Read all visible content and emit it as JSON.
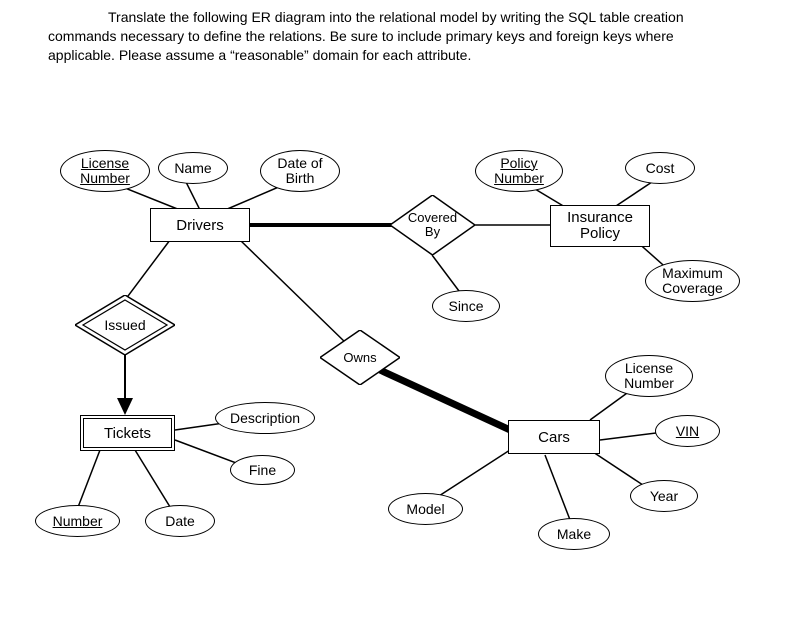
{
  "instructions": {
    "line1": "Translate the following ER diagram into the relational model by writing the SQL table creation",
    "line2": "commands necessary to define the relations. Be sure to include primary keys and foreign keys where",
    "line3": "applicable. Please assume a “reasonable” domain for each attribute."
  },
  "entities": {
    "drivers": {
      "label": "Drivers"
    },
    "insurance_policy": {
      "label": "Insurance\nPolicy"
    },
    "tickets": {
      "label": "Tickets"
    },
    "cars": {
      "label": "Cars"
    }
  },
  "relationships": {
    "covered_by": {
      "label": "Covered\nBy"
    },
    "issued": {
      "label": "Issued"
    },
    "owns": {
      "label": "Owns"
    }
  },
  "attributes": {
    "license_number_driver": {
      "label": "License\nNumber",
      "key": true
    },
    "name": {
      "label": "Name",
      "key": false
    },
    "date_of_birth": {
      "label": "Date of\nBirth",
      "key": false
    },
    "policy_number": {
      "label": "Policy\nNumber",
      "key": true
    },
    "cost": {
      "label": "Cost",
      "key": false
    },
    "maximum_coverage": {
      "label": "Maximum\nCoverage",
      "key": false
    },
    "since": {
      "label": "Since",
      "key": false
    },
    "description": {
      "label": "Description",
      "key": false
    },
    "fine": {
      "label": "Fine",
      "key": false
    },
    "number": {
      "label": "Number",
      "key": true
    },
    "date": {
      "label": "Date",
      "key": false
    },
    "model": {
      "label": "Model",
      "key": false
    },
    "make": {
      "label": "Make",
      "key": false
    },
    "year": {
      "label": "Year",
      "key": false
    },
    "vin": {
      "label": "VIN",
      "key": true
    },
    "license_number_car": {
      "label": "License\nNumber",
      "key": false
    }
  }
}
